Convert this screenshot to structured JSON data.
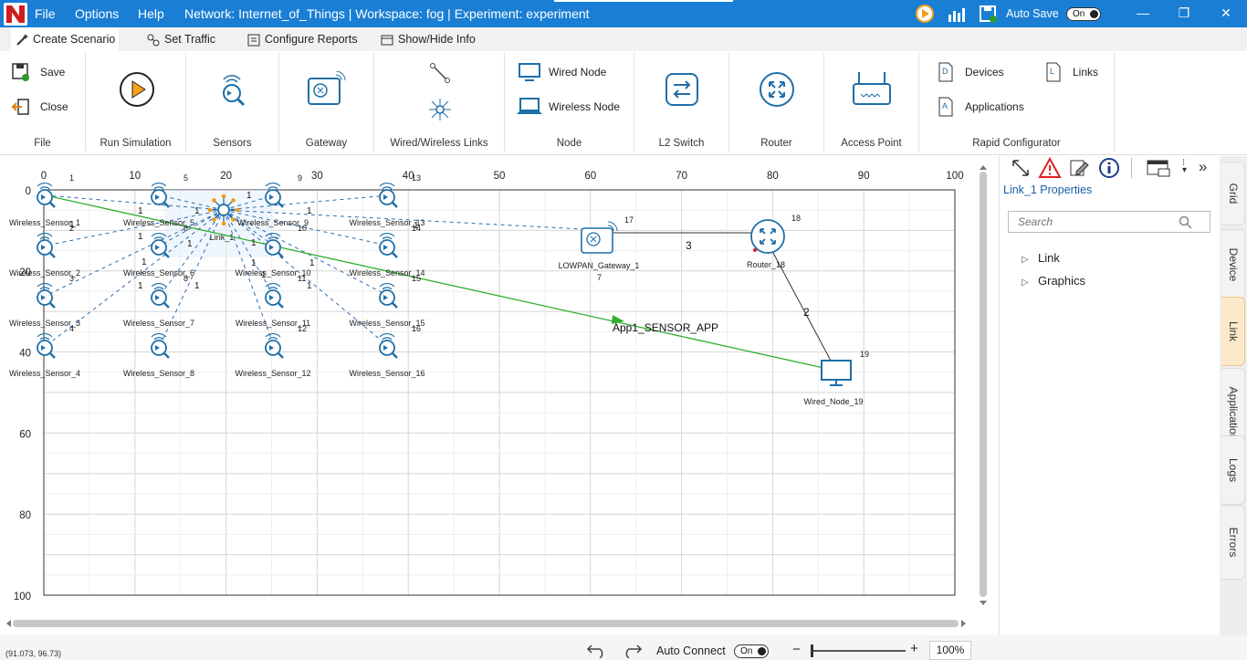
{
  "titlebar": {
    "menu": [
      "File",
      "Options",
      "Help"
    ],
    "title": "Network: Internet_of_Things | Workspace: fog | Experiment: experiment",
    "autosave_label": "Auto Save",
    "autosave_state": "On"
  },
  "ribbon_tabs": [
    "Create Scenario",
    "Set Traffic",
    "Configure Reports",
    "Show/Hide Info"
  ],
  "ribbon": {
    "file": {
      "save": "Save",
      "close": "Close",
      "label": "File"
    },
    "run": {
      "label": "Run Simulation"
    },
    "sensors": {
      "label": "Sensors"
    },
    "gateway": {
      "label": "Gateway"
    },
    "links": {
      "label": "Wired/Wireless Links"
    },
    "node": {
      "wired": "Wired Node",
      "wireless": "Wireless Node",
      "label": "Node"
    },
    "l2switch": {
      "label": "L2 Switch"
    },
    "router": {
      "label": "Router"
    },
    "access_point": {
      "label": "Access Point"
    },
    "rapid": {
      "devices": "Devices",
      "links": "Links",
      "applications": "Applications",
      "label": "Rapid Configurator"
    }
  },
  "canvas": {
    "x_ticks": [
      "0",
      "10",
      "20",
      "30",
      "40",
      "50",
      "60",
      "70",
      "80",
      "90",
      "100"
    ],
    "y_ticks": [
      "0",
      "20",
      "40",
      "60",
      "80",
      "100"
    ],
    "sensors": [
      {
        "label": "Wireless_Sensor_1",
        "id": "1"
      },
      {
        "label": "Wireless_Sensor_2",
        "id": "2"
      },
      {
        "label": "Wireless_Sensor_3",
        "id": "3"
      },
      {
        "label": "Wireless_Sensor_4",
        "id": "4"
      },
      {
        "label": "Wireless_Sensor_5",
        "id": "5"
      },
      {
        "label": "Wireless_Sensor_6",
        "id": "6"
      },
      {
        "label": "Wireless_Sensor_7",
        "id": "8"
      },
      {
        "label": "Wireless_Sensor_8",
        "id": ""
      },
      {
        "label": "Wireless_Sensor_9",
        "id": "9"
      },
      {
        "label": "Wireless_Sensor_10",
        "id": "10"
      },
      {
        "label": "Wireless_Sensor_11",
        "id": "11"
      },
      {
        "label": "Wireless_Sensor_12",
        "id": "12"
      },
      {
        "label": "Wireless_Sensor_13",
        "id": "13"
      },
      {
        "label": "Wireless_Sensor_14",
        "id": "14"
      },
      {
        "label": "Wireless_Sensor_15",
        "id": "15"
      },
      {
        "label": "Wireless_Sensor_16",
        "id": "16"
      }
    ],
    "hub": {
      "label": "Link_1"
    },
    "gateway": {
      "label": "LOWPAN_Gateway_1",
      "id": "17",
      "sub": "7"
    },
    "router": {
      "label": "Router_18",
      "id": "18"
    },
    "wired_node": {
      "label": "Wired_Node_19",
      "id": "19"
    },
    "link_labels": {
      "gw_router": "3",
      "router_node": "2",
      "wireless": "1"
    },
    "app_label": "App1_SENSOR_APP"
  },
  "panel": {
    "title": "Link_1 Properties",
    "search_placeholder": "Search",
    "tree": [
      "Link",
      "Graphics"
    ]
  },
  "side_tabs": [
    "Grid",
    "Device",
    "Link",
    "Application",
    "Logs",
    "Errors"
  ],
  "statusbar": {
    "coords": "(91.073, 96.73)",
    "auto_connect": "Auto Connect",
    "auto_connect_state": "On",
    "zoom": "100%"
  }
}
